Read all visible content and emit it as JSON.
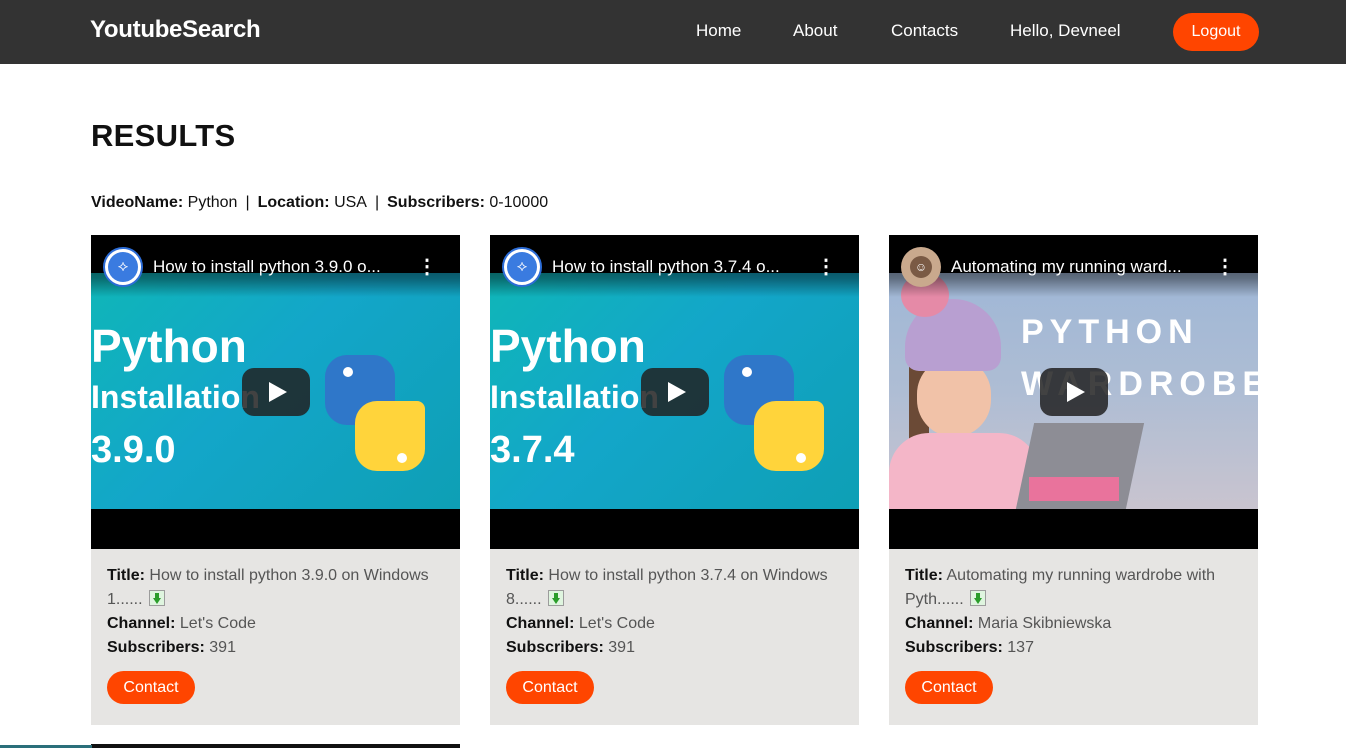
{
  "navbar": {
    "brand": "YoutubeSearch",
    "links": [
      "Home",
      "About",
      "Contacts",
      "Hello, Devneel"
    ],
    "logout_label": "Logout",
    "accent_color": "#ff4500"
  },
  "page": {
    "title": "RESULTS"
  },
  "filters": {
    "video_name_label": "VideoName:",
    "video_name_value": "Python",
    "location_label": "Location:",
    "location_value": "USA",
    "subscribers_label": "Subscribers:",
    "subscribers_value": "0-10000",
    "separator": "|"
  },
  "labels": {
    "title": "Title:",
    "channel": "Channel:",
    "subscribers": "Subscribers:",
    "contact_button": "Contact"
  },
  "results": [
    {
      "video_title": "How to install python 3.9.0 o...",
      "thumb_line1": "Python",
      "thumb_line2": "Installation",
      "thumb_line3": "3.9.0",
      "title": "How to install python 3.9.0 on Windows 1......",
      "channel": "Let's Code",
      "subscribers": "391"
    },
    {
      "video_title": "How to install python 3.7.4 o...",
      "thumb_line1": "Python",
      "thumb_line2": "Installation",
      "thumb_line3": "3.7.4",
      "title": "How to install python 3.7.4 on Windows 8......",
      "channel": "Let's Code",
      "subscribers": "391"
    },
    {
      "video_title": "Automating my running ward...",
      "thumb_line1": "PYTHON",
      "thumb_line2": "WARDROBE",
      "title": "Automating my running wardrobe with Pyth......",
      "channel": "Maria Skibniewska",
      "subscribers": "137"
    }
  ]
}
